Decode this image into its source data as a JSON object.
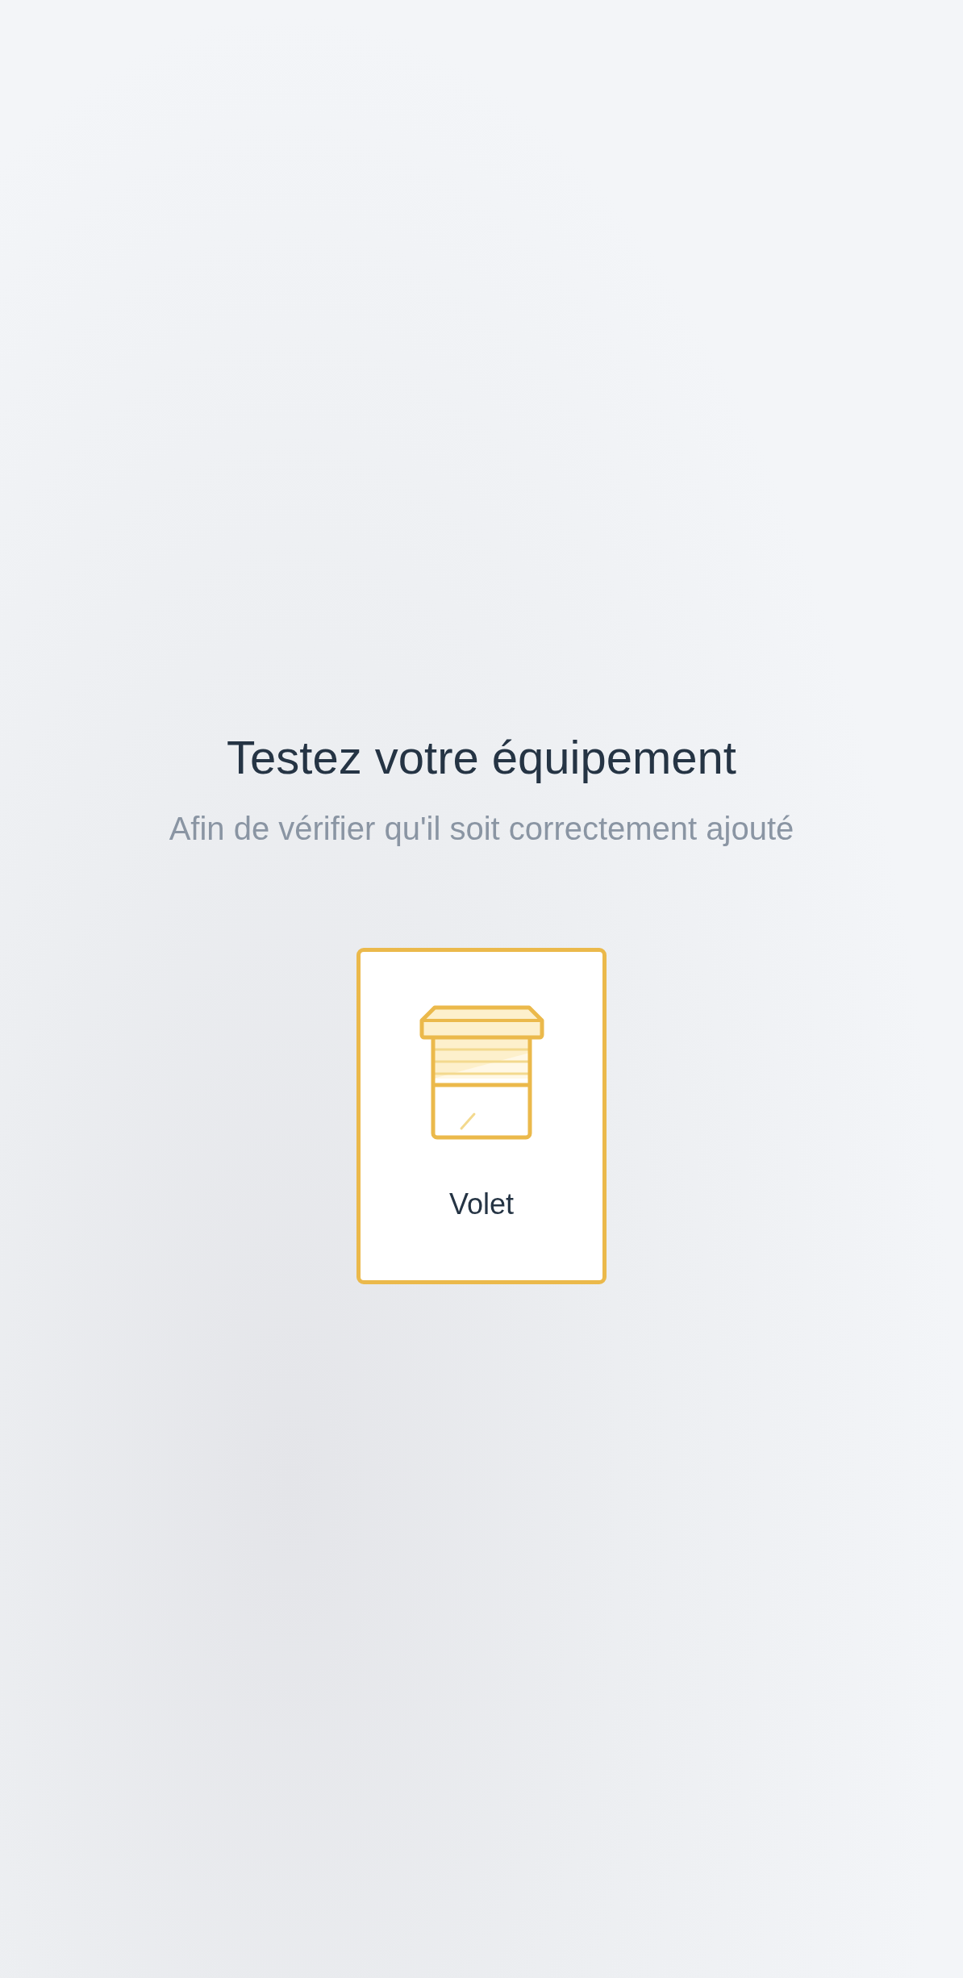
{
  "title": "Testez votre équipement",
  "subtitle": "Afin de vérifier qu'il soit correctement ajouté",
  "devices": [
    {
      "kind": "shutter",
      "label": "Volet",
      "selected": true
    }
  ]
}
